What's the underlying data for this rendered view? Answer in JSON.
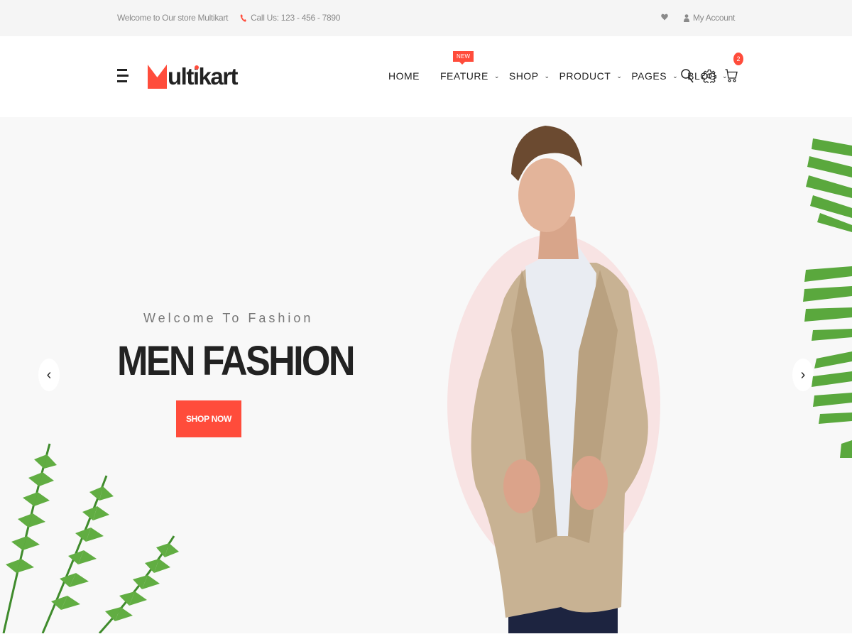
{
  "topbar": {
    "welcome": "Welcome to Our store Multikart",
    "call": "Call Us: 123 - 456 - 7890",
    "account": "My Account"
  },
  "header": {
    "logo_text": "ultikart",
    "nav": {
      "home": "HOME",
      "feature": "FEATURE",
      "feature_badge": "NEW",
      "shop": "SHOP",
      "product": "PRODUCT",
      "pages": "PAGES",
      "blog": "BLOG"
    },
    "cart_count": "2"
  },
  "hero": {
    "subtitle": "Welcome To Fashion",
    "title": "MEN FASHION",
    "button": "SHOP NOW",
    "prev_arrow": "‹",
    "next_arrow": "›"
  },
  "colors": {
    "accent": "#ff4c3b",
    "topbar_bg": "#f5f5f5",
    "hero_bg": "#f8f8f8",
    "circle": "#f8e3e3"
  },
  "icons": [
    "phone-icon",
    "heart-icon",
    "user-icon",
    "menu-icon",
    "logo-m-icon",
    "search-icon",
    "settings-icon",
    "cart-icon"
  ]
}
